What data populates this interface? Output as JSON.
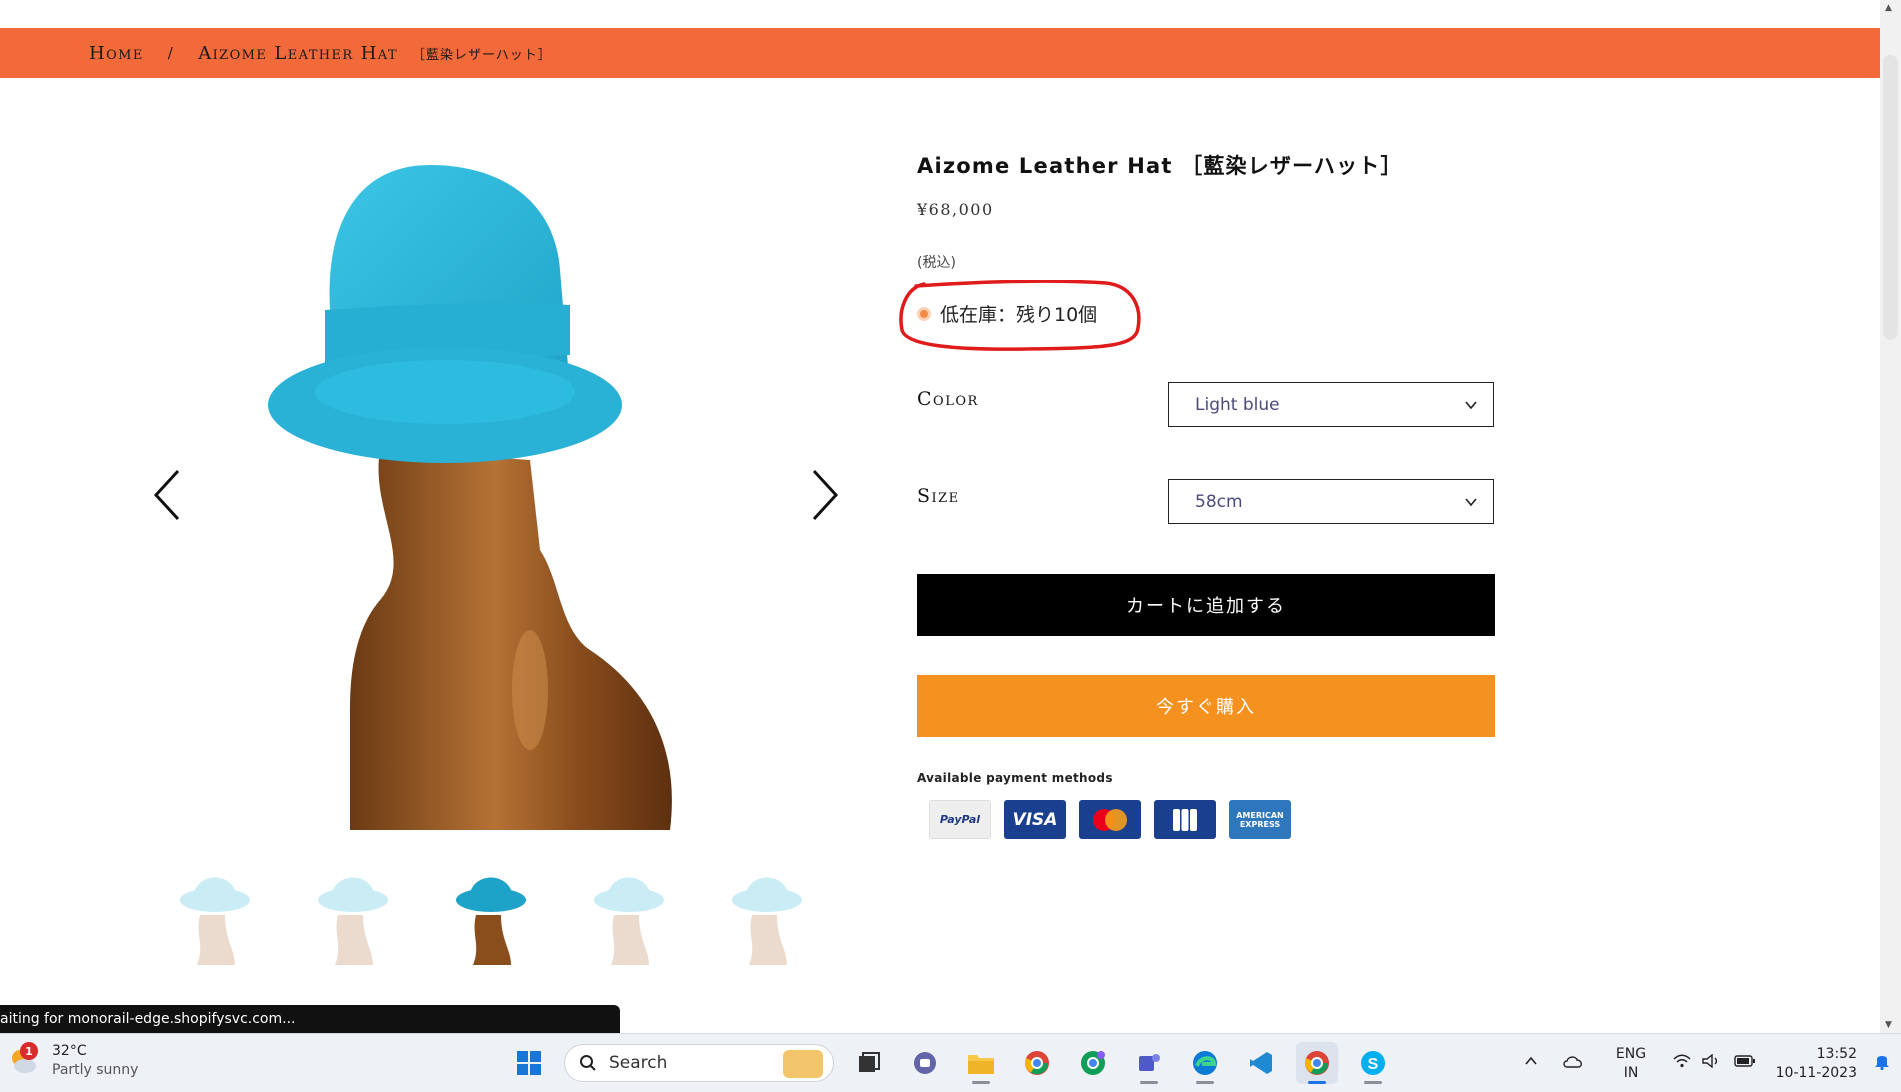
{
  "breadcrumb": {
    "home": "Home",
    "separator": "/",
    "current": "Aizome Leather Hat",
    "current_jp": "［藍染レザーハット］"
  },
  "product": {
    "title": "Aizome Leather Hat ［藍染レザーハット］",
    "price": "¥68,000",
    "tax_note": "(税込)",
    "stock": "低在庫：残り10個"
  },
  "options": {
    "color_label": "Color",
    "color_value": "Light blue",
    "size_label": "Size",
    "size_value": "58cm"
  },
  "buttons": {
    "add_to_cart": "カートに追加する",
    "buy_now": "今すぐ購入"
  },
  "payment": {
    "label": "Available payment methods",
    "methods": [
      "PayPal",
      "VISA",
      "MasterCard",
      "JCB",
      "AMERICAN EXPRESS"
    ]
  },
  "gallery": {
    "thumbnail_count": 5,
    "active_thumbnail": 3
  },
  "browser_status": "aiting for monorail-edge.shopifysvc.com...",
  "taskbar": {
    "weather_temp": "32°C",
    "weather_desc": "Partly sunny",
    "weather_badge": "1",
    "search_label": "Search",
    "lang_top": "ENG",
    "lang_bottom": "IN",
    "time": "13:52",
    "date": "10-11-2023"
  },
  "colors": {
    "breadcrumb_bar": "#f2693a",
    "buy_now": "#f5911f",
    "add_to_cart": "#000000",
    "annotation": "#e01b1b",
    "hat": "#2bb6d8",
    "stand": "#9a5a24"
  }
}
